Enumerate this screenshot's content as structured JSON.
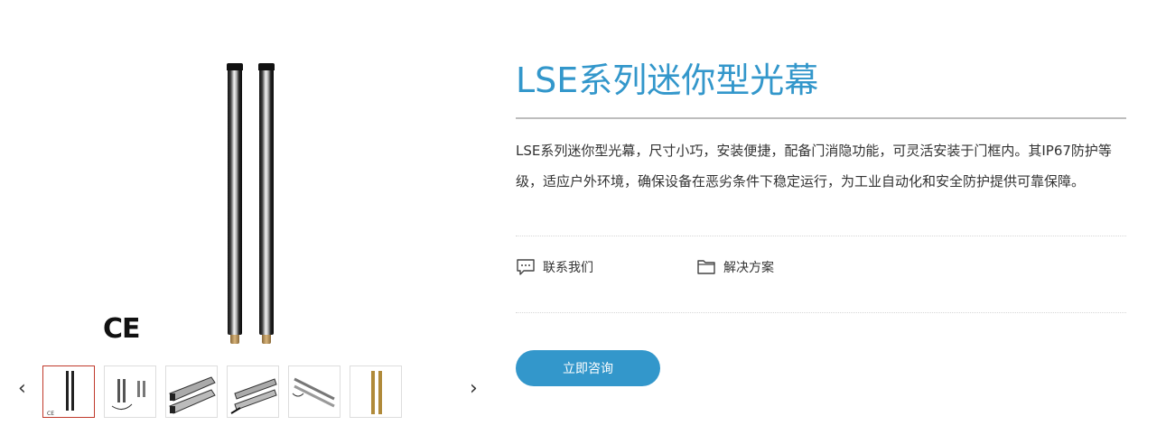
{
  "gallery": {
    "ce_mark": "CE",
    "prev_arrow": "‹",
    "next_arrow": "›",
    "thumbnails": [
      {
        "label": "thumbnail-1",
        "active": true
      },
      {
        "label": "thumbnail-2",
        "active": false
      },
      {
        "label": "thumbnail-3",
        "active": false
      },
      {
        "label": "thumbnail-4",
        "active": false
      },
      {
        "label": "thumbnail-5",
        "active": false
      },
      {
        "label": "thumbnail-6",
        "active": false
      }
    ]
  },
  "product": {
    "title": "LSE系列迷你型光幕",
    "description": "LSE系列迷你型光幕，尺寸小巧，安装便捷，配备门消隐功能，可灵活安装于门框内。其IP67防护等级，适应户外环境，确保设备在恶劣条件下稳定运行，为工业自动化和安全防护提供可靠保障。"
  },
  "links": {
    "contact": {
      "label": "联系我们",
      "icon": "chat-icon"
    },
    "solutions": {
      "label": "解决方案",
      "icon": "folder-icon"
    }
  },
  "cta": {
    "label": "立即咨询"
  },
  "colors": {
    "accent": "#3397cb",
    "active_thumb_border": "#c0392b"
  }
}
